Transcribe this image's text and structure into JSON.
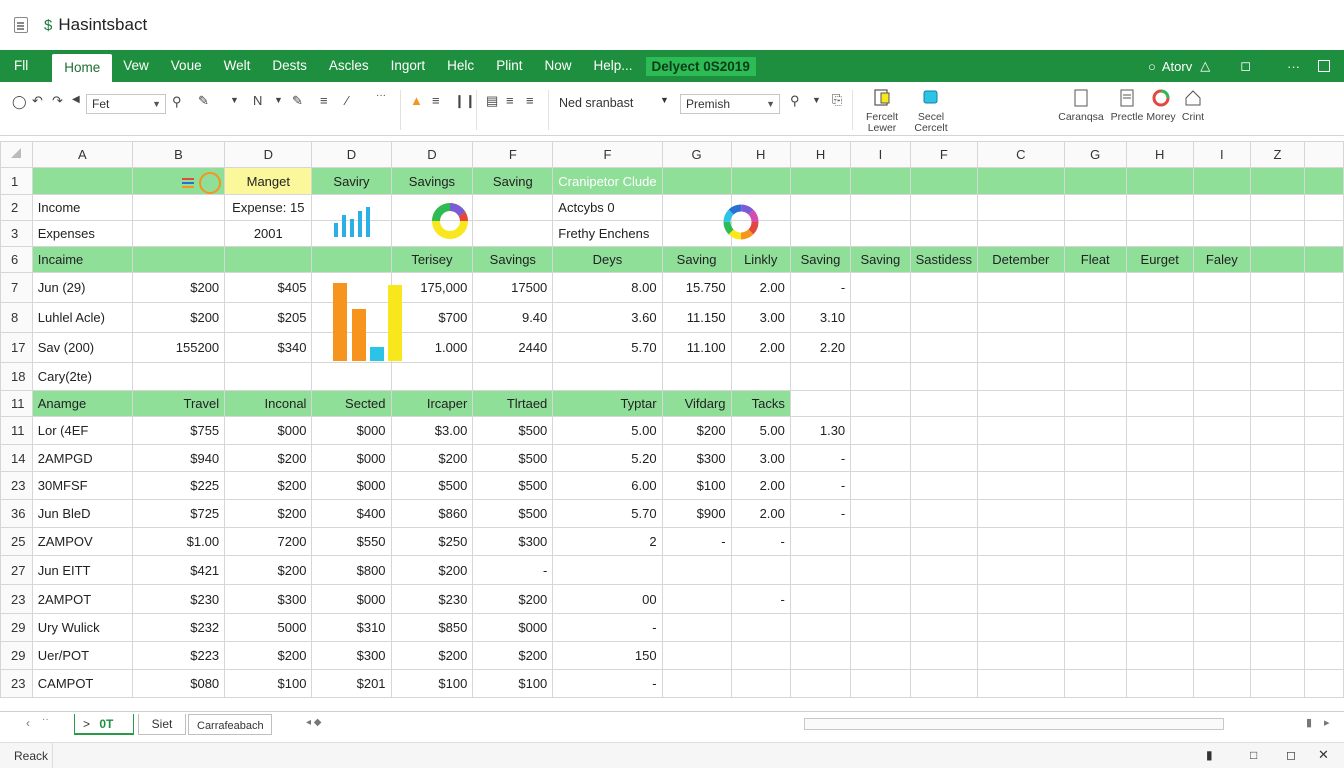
{
  "window": {
    "title": "Hasintsbact"
  },
  "menu": {
    "items": [
      "Fll",
      "Home",
      "Vew",
      "Voue",
      "Welt",
      "Dests",
      "Ascles",
      "Ingort",
      "Helc",
      "Plint",
      "Now",
      "Help..."
    ],
    "doc_label": "Delyect 0S2019",
    "account_label": "Atorv"
  },
  "ribbon": {
    "font_name": "Fet",
    "format_combo": "Ned sranbast",
    "style_combo": "Premish",
    "buttons": [
      {
        "label_1": "Fercelt",
        "label_2": "Lewer"
      },
      {
        "label_1": "Secel",
        "label_2": "Cercelt"
      }
    ],
    "right_labels": [
      "Caranqsa",
      "Prectle",
      "Morey",
      "Crint"
    ]
  },
  "grid": {
    "col_headers": [
      "A",
      "B",
      "D",
      "D",
      "D",
      "F",
      "F",
      "G",
      "H",
      "H",
      "I",
      "F",
      "C",
      "G",
      "H",
      "I",
      "Z"
    ],
    "rows": [
      {
        "rh": "1",
        "cells": [
          "",
          "",
          "Manget",
          "Saviry",
          "Savings",
          "Saving",
          "Cranipetor Clude",
          "",
          "",
          "",
          "",
          "",
          "",
          "",
          "",
          "",
          ""
        ]
      },
      {
        "rh": "2",
        "cells": [
          "Income",
          "",
          "Expense: 15",
          "",
          "",
          "",
          "Actcybs 0",
          "",
          "",
          "",
          "",
          "",
          "",
          "",
          "",
          "",
          ""
        ]
      },
      {
        "rh": "3",
        "cells": [
          "Expenses",
          "",
          "2001",
          "",
          "",
          "",
          "Frethy Enchens",
          "",
          "",
          "",
          "",
          "",
          "",
          "",
          "",
          "",
          ""
        ]
      },
      {
        "rh": "6",
        "cells": [
          "Incaime",
          "",
          "",
          "",
          "Terisey",
          "Savings",
          "Deys",
          "Saving",
          "Linkly",
          "Saving",
          "Saving",
          "Sastidess",
          "Detember",
          "Fleat",
          "Eurget",
          "Faley",
          ""
        ]
      },
      {
        "rh": "7",
        "cells": [
          "Jun (29)",
          "$200",
          "$405",
          "",
          "175,000",
          "17500",
          "8.00",
          "15.750",
          "2.00",
          "-",
          "",
          "",
          "",
          "",
          "",
          "",
          ""
        ]
      },
      {
        "rh": "8",
        "cells": [
          "Luhlel Acle)",
          "$200",
          "$205",
          "",
          "$700",
          "9.40",
          "3.60",
          "11.150",
          "3.00",
          "3.10",
          "",
          "",
          "",
          "",
          "",
          "",
          ""
        ]
      },
      {
        "rh": "17",
        "cells": [
          "Sav (200)",
          "155200",
          "$340",
          "",
          "1.000",
          "2440",
          "5.70",
          "11.100",
          "2.00",
          "2.20",
          "",
          "",
          "",
          "",
          "",
          "",
          ""
        ]
      },
      {
        "rh": "18",
        "cells": [
          "Cary(2te)",
          "",
          "",
          "",
          "",
          "",
          "",
          "",
          "",
          "",
          "",
          "",
          "",
          "",
          "",
          "",
          ""
        ]
      },
      {
        "rh": "11",
        "cells": [
          "Anamge",
          "Travel",
          "Inconal",
          "Sected",
          "Ircaper",
          "Tlrtaed",
          "Typtar",
          "Vifdarg",
          "Tacks",
          "",
          "",
          "",
          "",
          "",
          "",
          "",
          ""
        ]
      },
      {
        "rh": "11",
        "cells": [
          "Lor (4EF",
          "$755",
          "$000",
          "$000",
          "$3.00",
          "$500",
          "5.00",
          "$200",
          "5.00",
          "1.30",
          "",
          "",
          "",
          "",
          "",
          "",
          ""
        ]
      },
      {
        "rh": "14",
        "cells": [
          "2AMPGD",
          "$940",
          "$200",
          "$000",
          "$200",
          "$500",
          "5.20",
          "$300",
          "3.00",
          "-",
          "",
          "",
          "",
          "",
          "",
          "",
          ""
        ]
      },
      {
        "rh": "23",
        "cells": [
          "30MFSF",
          "$225",
          "$200",
          "$000",
          "$500",
          "$500",
          "6.00",
          "$100",
          "2.00",
          "-",
          "",
          "",
          "",
          "",
          "",
          "",
          ""
        ]
      },
      {
        "rh": "36",
        "cells": [
          "Jun BleD",
          "$725",
          "$200",
          "$400",
          "$860",
          "$500",
          "5.70",
          "$900",
          "2.00",
          "-",
          "",
          "",
          "",
          "",
          "",
          "",
          ""
        ]
      },
      {
        "rh": "25",
        "cells": [
          "ZAMPOV",
          "$1.00",
          "7200",
          "$550",
          "$250",
          "$300",
          "2",
          "-",
          "-",
          "",
          "",
          "",
          "",
          "",
          "",
          "",
          ""
        ]
      },
      {
        "rh": "27",
        "cells": [
          "Jun EITT",
          "$421",
          "$200",
          "$800",
          "$200",
          "-",
          "",
          "",
          "",
          "",
          "",
          "",
          "",
          "",
          "",
          "",
          ""
        ]
      },
      {
        "rh": "23",
        "cells": [
          "2AMPOT",
          "$230",
          "$300",
          "$000",
          "$230",
          "$200",
          "00",
          "",
          "-",
          "",
          "",
          "",
          "",
          "",
          "",
          "",
          ""
        ]
      },
      {
        "rh": "29",
        "cells": [
          "Ury Wulick",
          "$232",
          "5000",
          "$310",
          "$850",
          "$000",
          "-",
          "",
          "",
          "",
          "",
          "",
          "",
          "",
          "",
          "",
          ""
        ]
      },
      {
        "rh": "29",
        "cells": [
          "Uer/POT",
          "$223",
          "$200",
          "$300",
          "$200",
          "$200",
          "150",
          "",
          "",
          "",
          "",
          "",
          "",
          "",
          "",
          "",
          ""
        ]
      },
      {
        "rh": "23",
        "cells": [
          "CAMPOT",
          "$080",
          "$100",
          "$201",
          "$100",
          "$100",
          "-",
          "",
          "",
          "",
          "",
          "",
          "",
          "",
          "",
          "",
          ""
        ]
      }
    ]
  },
  "sheet_tabs": {
    "tabs": [
      "0T",
      "Siet",
      "Carrafeabach"
    ]
  },
  "status": {
    "text": "Reack"
  },
  "colors": {
    "brand_green": "#1e8f3e",
    "band_green": "#8fdf99",
    "highlight_yellow": "#fbf79b",
    "orange_bar": "#f7941d",
    "yellow_bar": "#f9e71e",
    "cyan_bar": "#2bc4e6"
  },
  "icons": [
    "document-icon",
    "undo-icon",
    "redo-icon",
    "brush-icon",
    "bold-icon",
    "italic-icon",
    "align-icon",
    "chart-icon",
    "search-icon",
    "settings-icon",
    "account-icon",
    "restore-icon",
    "more-icon",
    "close-icon"
  ]
}
